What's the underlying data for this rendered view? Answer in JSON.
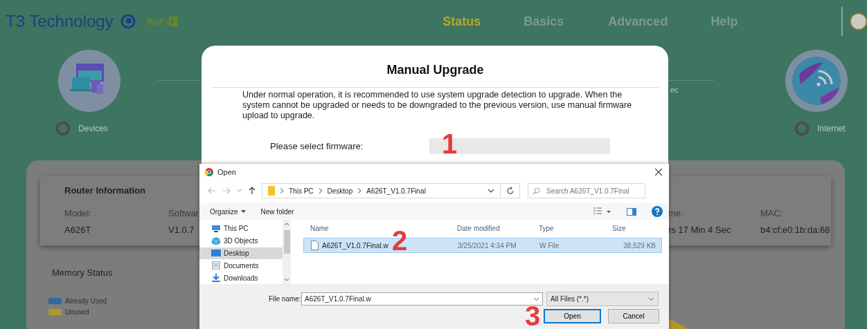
{
  "header": {
    "brand": "T3 Technology",
    "wifi_logo": {
      "text": "WiFi",
      "number": "6"
    }
  },
  "nav": [
    {
      "label": "Status",
      "selected": true
    },
    {
      "label": "Basics",
      "selected": false
    },
    {
      "label": "Advanced",
      "selected": false
    },
    {
      "label": "Help",
      "selected": false
    }
  ],
  "status_nodes": [
    {
      "kind": "devices",
      "label": "Devices"
    },
    {
      "kind": "internet",
      "label": "Internet"
    }
  ],
  "link_fragment": "ec",
  "router_info": {
    "title": "Router Information",
    "fields": [
      {
        "label": "Model:",
        "value": "A626T"
      },
      {
        "label": "Softwar",
        "value": "V1.0.7"
      },
      {
        "label": "me:",
        "value": "rs 17 Min 4 Sec"
      },
      {
        "label": "MAC:",
        "value": "b4:cf:e0:1b:da:68"
      }
    ]
  },
  "memory": {
    "title": "Memory Status",
    "legend": [
      {
        "label": "Already Used",
        "color": "#2e6b9c"
      },
      {
        "label": "Unused",
        "color": "#b3962c"
      }
    ]
  },
  "modal": {
    "title": "Manual Upgrade",
    "description": "Under normal operation, it is recommended to use system upgrade detection to upgrade. When the system cannot be upgraded or needs to be downgraded to the previous version, use manual firmware upload to upgrade.",
    "firmware_label": "Please select firmware:"
  },
  "open_dialog": {
    "title": "Open",
    "path": [
      "This PC",
      "Desktop",
      "A626T_V1.0.7Final"
    ],
    "search": {
      "placeholder": "Search A626T_V1.0.7Final"
    },
    "toolbar": [
      "Organize",
      "New folder"
    ],
    "nav_items": [
      {
        "label": "This PC",
        "kind": "pc",
        "selected": false
      },
      {
        "label": "3D Objects",
        "kind": "objects",
        "selected": false
      },
      {
        "label": "Desktop",
        "kind": "desktop",
        "selected": true
      },
      {
        "label": "Documents",
        "kind": "documents",
        "selected": false
      },
      {
        "label": "Downloads",
        "kind": "downloads",
        "selected": false
      }
    ],
    "columns": [
      "Name",
      "Date modified",
      "Type",
      "Size"
    ],
    "files": [
      {
        "name": "A626T_V1.0.7Final.w",
        "date": "3/25/2021 4:34 PM",
        "type": "W File",
        "size": "38,529 KB",
        "selected": true
      }
    ],
    "file_name_label": "File name:",
    "file_name": "A626T_V1.0.7Final.w",
    "filter": "All Files (*.*)",
    "buttons": [
      {
        "label": "Open",
        "focused": true
      },
      {
        "label": "Cancel",
        "focused": false
      }
    ]
  },
  "annotations": [
    "1",
    "2",
    "3"
  ]
}
